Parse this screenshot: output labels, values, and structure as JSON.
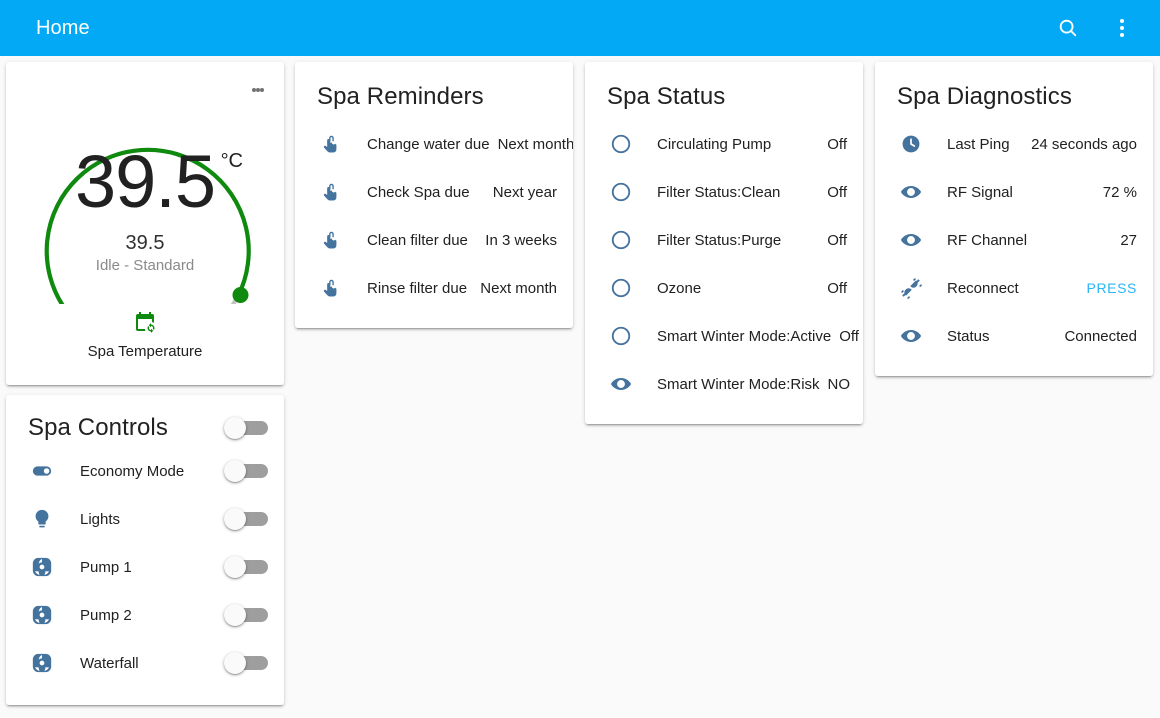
{
  "app": {
    "title": "Home",
    "accent_color": "#03a9f4",
    "search_icon": "search-icon",
    "overflow_icon": "more-vert-icon"
  },
  "temperature_card": {
    "menu_icon": "more-vert-icon",
    "value": "39.5",
    "unit": "°C",
    "secondary_value": "39.5",
    "state": "Idle - Standard",
    "footer_icon": "calendar-sync-icon",
    "footer_name": "Spa Temperature",
    "gauge_color": "#0f8a0f",
    "gauge_min": 0,
    "gauge_max": 45,
    "gauge_fraction": 0.9
  },
  "controls_card": {
    "title": "Spa Controls",
    "header_toggle": {
      "state": "off"
    },
    "items": [
      {
        "icon": "toggle-switch-icon",
        "label": "Economy Mode",
        "state": "off"
      },
      {
        "icon": "lightbulb-icon",
        "label": "Lights",
        "state": "off"
      },
      {
        "icon": "pump-icon",
        "label": "Pump 1",
        "state": "off"
      },
      {
        "icon": "pump-icon",
        "label": "Pump 2",
        "state": "off"
      },
      {
        "icon": "pump-icon",
        "label": "Waterfall",
        "state": "off"
      }
    ]
  },
  "reminders_card": {
    "title": "Spa Reminders",
    "items": [
      {
        "icon": "gesture-tap-icon",
        "label": "Change water due",
        "value": "Next month"
      },
      {
        "icon": "gesture-tap-icon",
        "label": "Check Spa due",
        "value": "Next year"
      },
      {
        "icon": "gesture-tap-icon",
        "label": "Clean filter due",
        "value": "In 3 weeks"
      },
      {
        "icon": "gesture-tap-icon",
        "label": "Rinse filter due",
        "value": "Next month"
      }
    ]
  },
  "status_card": {
    "title": "Spa Status",
    "items": [
      {
        "icon": "circle-outline-icon",
        "label": "Circulating Pump",
        "value": "Off"
      },
      {
        "icon": "circle-outline-icon",
        "label": "Filter Status:Clean",
        "value": "Off"
      },
      {
        "icon": "circle-outline-icon",
        "label": "Filter Status:Purge",
        "value": "Off"
      },
      {
        "icon": "circle-outline-icon",
        "label": "Ozone",
        "value": "Off"
      },
      {
        "icon": "circle-outline-icon",
        "label": "Smart Winter Mode:Active",
        "value": "Off"
      },
      {
        "icon": "eye-icon",
        "label": "Smart Winter Mode:Risk",
        "value": "NO"
      }
    ]
  },
  "diagnostics_card": {
    "title": "Spa Diagnostics",
    "items": [
      {
        "icon": "clock-icon",
        "label": "Last Ping",
        "value": "24 seconds ago",
        "action": false
      },
      {
        "icon": "eye-icon",
        "label": "RF Signal",
        "value": "72 %",
        "action": false
      },
      {
        "icon": "eye-icon",
        "label": "RF Channel",
        "value": "27",
        "action": false
      },
      {
        "icon": "connection-icon",
        "label": "Reconnect",
        "value": "PRESS",
        "action": true
      },
      {
        "icon": "eye-icon",
        "label": "Status",
        "value": "Connected",
        "action": false
      }
    ]
  }
}
